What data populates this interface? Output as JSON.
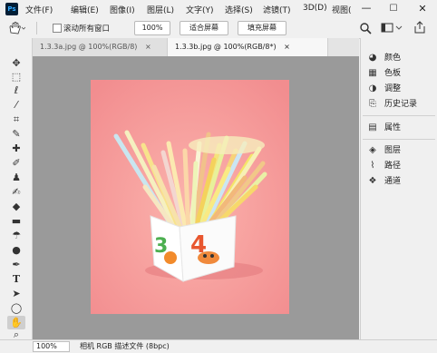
{
  "app": {
    "logo": "Ps"
  },
  "menu": [
    "文件(F)",
    "编辑(E)",
    "图像(I)",
    "图层(L)",
    "文字(Y)",
    "选择(S)",
    "滤镜(T)",
    "3D(D)",
    "视图("
  ],
  "window_controls": {
    "minimize": "—",
    "maximize": "☐",
    "close": "✕"
  },
  "options": {
    "scroll_all_label": "滚动所有窗口",
    "zoom_value": "100%",
    "fit_screen": "适合屏幕",
    "fill_screen": "填充屏幕",
    "right_icons": [
      "search-icon",
      "workspace-icon",
      "share-icon"
    ]
  },
  "tabs": [
    {
      "title": "1.3.3a.jpg @ 100%(RGB/8)",
      "close": "×",
      "active": false
    },
    {
      "title": "1.3.3b.jpg @ 100%(RGB/8*)",
      "close": "×",
      "active": true
    }
  ],
  "tools": [
    "move-tool-icon",
    "marquee-tool-icon",
    "lasso-tool-icon",
    "magic-wand-icon",
    "crop-tool-icon",
    "eyedropper-icon",
    "healing-brush-icon",
    "brush-tool-icon",
    "clone-stamp-icon",
    "history-brush-icon",
    "eraser-icon",
    "gradient-tool-icon",
    "blur-tool-icon",
    "dodge-tool-icon",
    "pen-tool-icon",
    "type-tool-icon",
    "path-select-icon",
    "ellipse-tool-icon",
    "hand-tool-icon",
    "zoom-tool-icon"
  ],
  "panels_group1": [
    {
      "label": "颜色",
      "icon": "color-icon"
    },
    {
      "label": "色板",
      "icon": "swatches-icon"
    },
    {
      "label": "调整",
      "icon": "adjustments-icon"
    },
    {
      "label": "历史记录",
      "icon": "history-icon"
    }
  ],
  "panels_group2": [
    {
      "label": "属性",
      "icon": "properties-icon"
    }
  ],
  "panels_group3": [
    {
      "label": "图层",
      "icon": "layers-icon"
    },
    {
      "label": "路径",
      "icon": "paths-icon"
    },
    {
      "label": "通道",
      "icon": "channels-icon"
    }
  ],
  "status": {
    "zoom": "100%",
    "info": "相机 RGB 描述文件 (8bpc)"
  },
  "colors": {
    "canvas_bg": "#9a9a9a",
    "photo_bg": "#f79a9a",
    "accent": "#31a8ff"
  }
}
